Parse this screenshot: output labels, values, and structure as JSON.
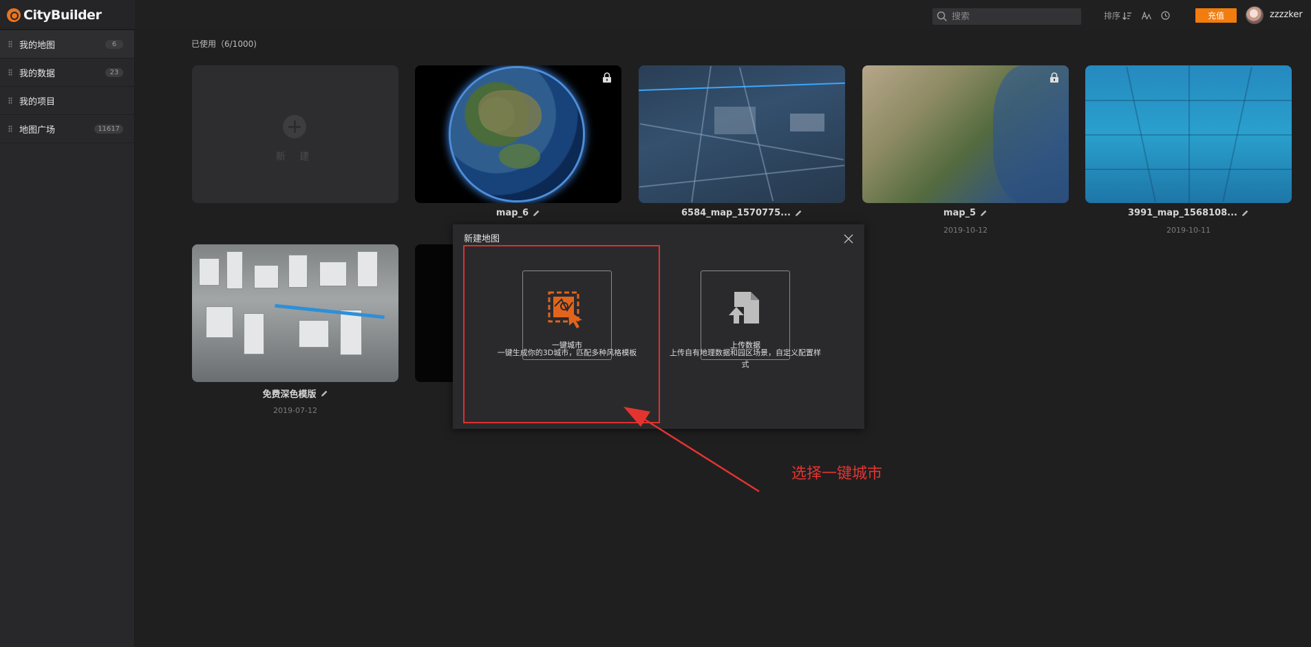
{
  "header": {
    "logo_text": "CityBuilder",
    "search": {
      "placeholder": "搜索",
      "value": ""
    },
    "tools": {
      "sort_label": "排序"
    },
    "recharge_label": "充值",
    "username": "zzzzker"
  },
  "sidebar": {
    "items": [
      {
        "label": "我的地图",
        "count": "6"
      },
      {
        "label": "我的数据",
        "count": "23"
      },
      {
        "label": "我的项目",
        "count": ""
      },
      {
        "label": "地图广场",
        "count": "11617"
      }
    ]
  },
  "main": {
    "usage_text": "已使用（6/1000)",
    "new_label": "新 建",
    "cards": [
      {
        "title": "map_6",
        "date": "",
        "locked": true
      },
      {
        "title": "6584_map_1570775...",
        "date": "",
        "locked": false
      },
      {
        "title": "map_5",
        "date": "2019-10-12",
        "locked": true
      },
      {
        "title": "3991_map_1568108...",
        "date": "2019-10-11",
        "locked": false
      },
      {
        "title": "免费深色模版",
        "date": "2019-07-12",
        "locked": false
      }
    ]
  },
  "modal": {
    "title": "新建地图",
    "options": [
      {
        "label": "一键城市",
        "description": "一键生成你的3D城市，匹配多种风格模板"
      },
      {
        "label": "上传数据",
        "description": "上传自有地理数据和园区场景，自定义配置样式"
      }
    ]
  },
  "annotation": {
    "text": "选择一键城市",
    "color": "#e5342f"
  },
  "colors": {
    "accent": "#f27c0e",
    "highlight": "#e0302d"
  }
}
